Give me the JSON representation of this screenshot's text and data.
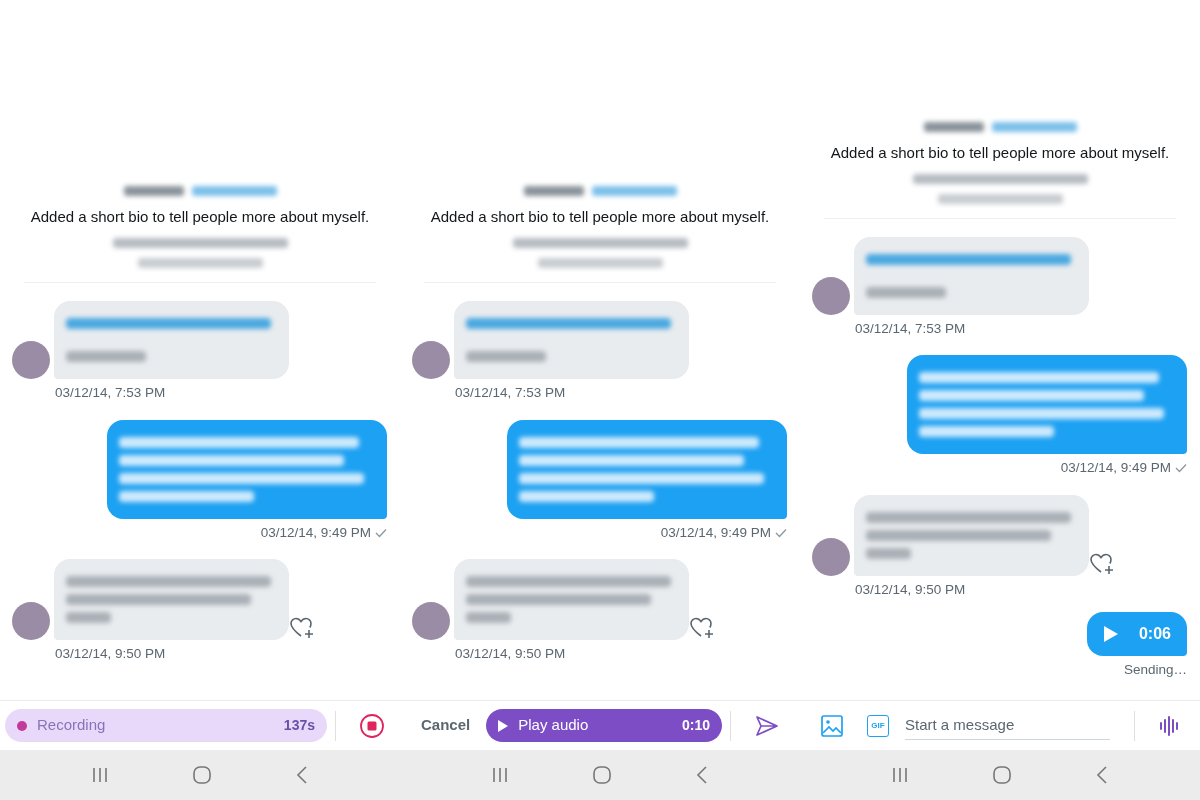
{
  "panels": [
    {
      "profile": {
        "bio": "Added a short bio to tell people more about myself."
      },
      "messages": [
        {
          "kind": "received_link",
          "timestamp": "03/12/14, 7:53 PM"
        },
        {
          "kind": "sent",
          "timestamp": "03/12/14, 9:49 PM",
          "delivered": true
        },
        {
          "kind": "received",
          "timestamp": "03/12/14, 9:50 PM",
          "like_button": true
        }
      ],
      "composer": {
        "kind": "recording",
        "label": "Recording",
        "duration": "137s"
      }
    },
    {
      "profile": {
        "bio": "Added a short bio to tell people more about myself."
      },
      "messages": [
        {
          "kind": "received_link",
          "timestamp": "03/12/14, 7:53 PM"
        },
        {
          "kind": "sent",
          "timestamp": "03/12/14, 9:49 PM",
          "delivered": true
        },
        {
          "kind": "received",
          "timestamp": "03/12/14, 9:50 PM",
          "like_button": true
        }
      ],
      "composer": {
        "kind": "playback",
        "cancel": "Cancel",
        "label": "Play audio",
        "duration": "0:10"
      }
    },
    {
      "profile": {
        "bio": "Added a short bio to tell people more about myself."
      },
      "messages": [
        {
          "kind": "received_link",
          "timestamp": "03/12/14, 7:53 PM"
        },
        {
          "kind": "sent",
          "timestamp": "03/12/14, 9:49 PM",
          "delivered": true
        },
        {
          "kind": "received",
          "timestamp": "03/12/14, 9:50 PM",
          "like_button": true
        },
        {
          "kind": "voice",
          "duration": "0:06",
          "status": "Sending…"
        }
      ],
      "composer": {
        "kind": "compose",
        "gif": "GIF",
        "placeholder": "Start a message"
      }
    }
  ]
}
